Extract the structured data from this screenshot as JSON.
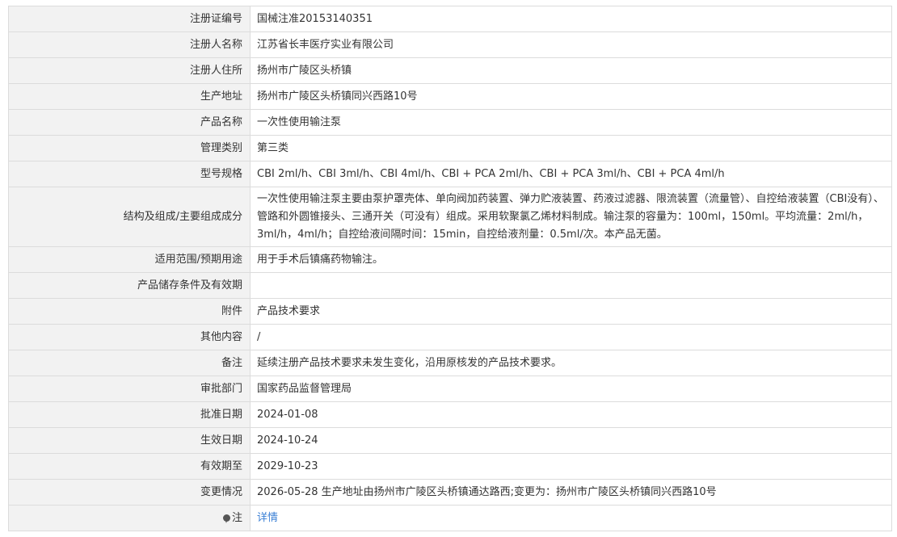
{
  "rows": [
    {
      "label": "注册证编号",
      "value": "国械注准20153140351"
    },
    {
      "label": "注册人名称",
      "value": "江苏省长丰医疗实业有限公司"
    },
    {
      "label": "注册人住所",
      "value": "扬州市广陵区头桥镇"
    },
    {
      "label": "生产地址",
      "value": "扬州市广陵区头桥镇同兴西路10号"
    },
    {
      "label": "产品名称",
      "value": "一次性使用输注泵"
    },
    {
      "label": "管理类别",
      "value": "第三类"
    },
    {
      "label": "型号规格",
      "value": "CBI 2ml/h、CBI 3ml/h、CBI 4ml/h、CBI + PCA 2ml/h、CBI + PCA 3ml/h、CBI + PCA 4ml/h"
    },
    {
      "label": "结构及组成/主要组成成分",
      "value": "一次性使用输注泵主要由泵护罩壳体、单向阀加药装置、弹力贮液装置、药液过滤器、限流装置（流量管）、自控给液装置（CBI没有）、管路和外圆锥接头、三通开关（可没有）组成。采用软聚氯乙烯材料制成。输注泵的容量为：100ml，150ml。平均流量：2ml/h，3ml/h，4ml/h；自控给液间隔时间：15min，自控给液剂量：0.5ml/次。本产品无菌。"
    },
    {
      "label": "适用范围/预期用途",
      "value": "用于手术后镇痛药物输注。"
    },
    {
      "label": "产品储存条件及有效期",
      "value": ""
    },
    {
      "label": "附件",
      "value": "产品技术要求"
    },
    {
      "label": "其他内容",
      "value": "/"
    },
    {
      "label": "备注",
      "value": "延续注册产品技术要求未发生变化，沿用原核发的产品技术要求。"
    },
    {
      "label": "审批部门",
      "value": "国家药品监督管理局"
    },
    {
      "label": "批准日期",
      "value": "2024-01-08"
    },
    {
      "label": "生效日期",
      "value": "2024-10-24"
    },
    {
      "label": "有效期至",
      "value": "2029-10-23"
    },
    {
      "label": "变更情况",
      "value": "2026-05-28 生产地址由扬州市广陵区头桥镇通达路西;变更为：扬州市广陵区头桥镇同兴西路10号"
    }
  ],
  "note_row": {
    "label": "注",
    "icon": "location-pin-icon",
    "link": "详情"
  },
  "colors": {
    "label_bg": "#f2f2f2",
    "border": "#dcdcdc",
    "link": "#3a7fd5"
  }
}
